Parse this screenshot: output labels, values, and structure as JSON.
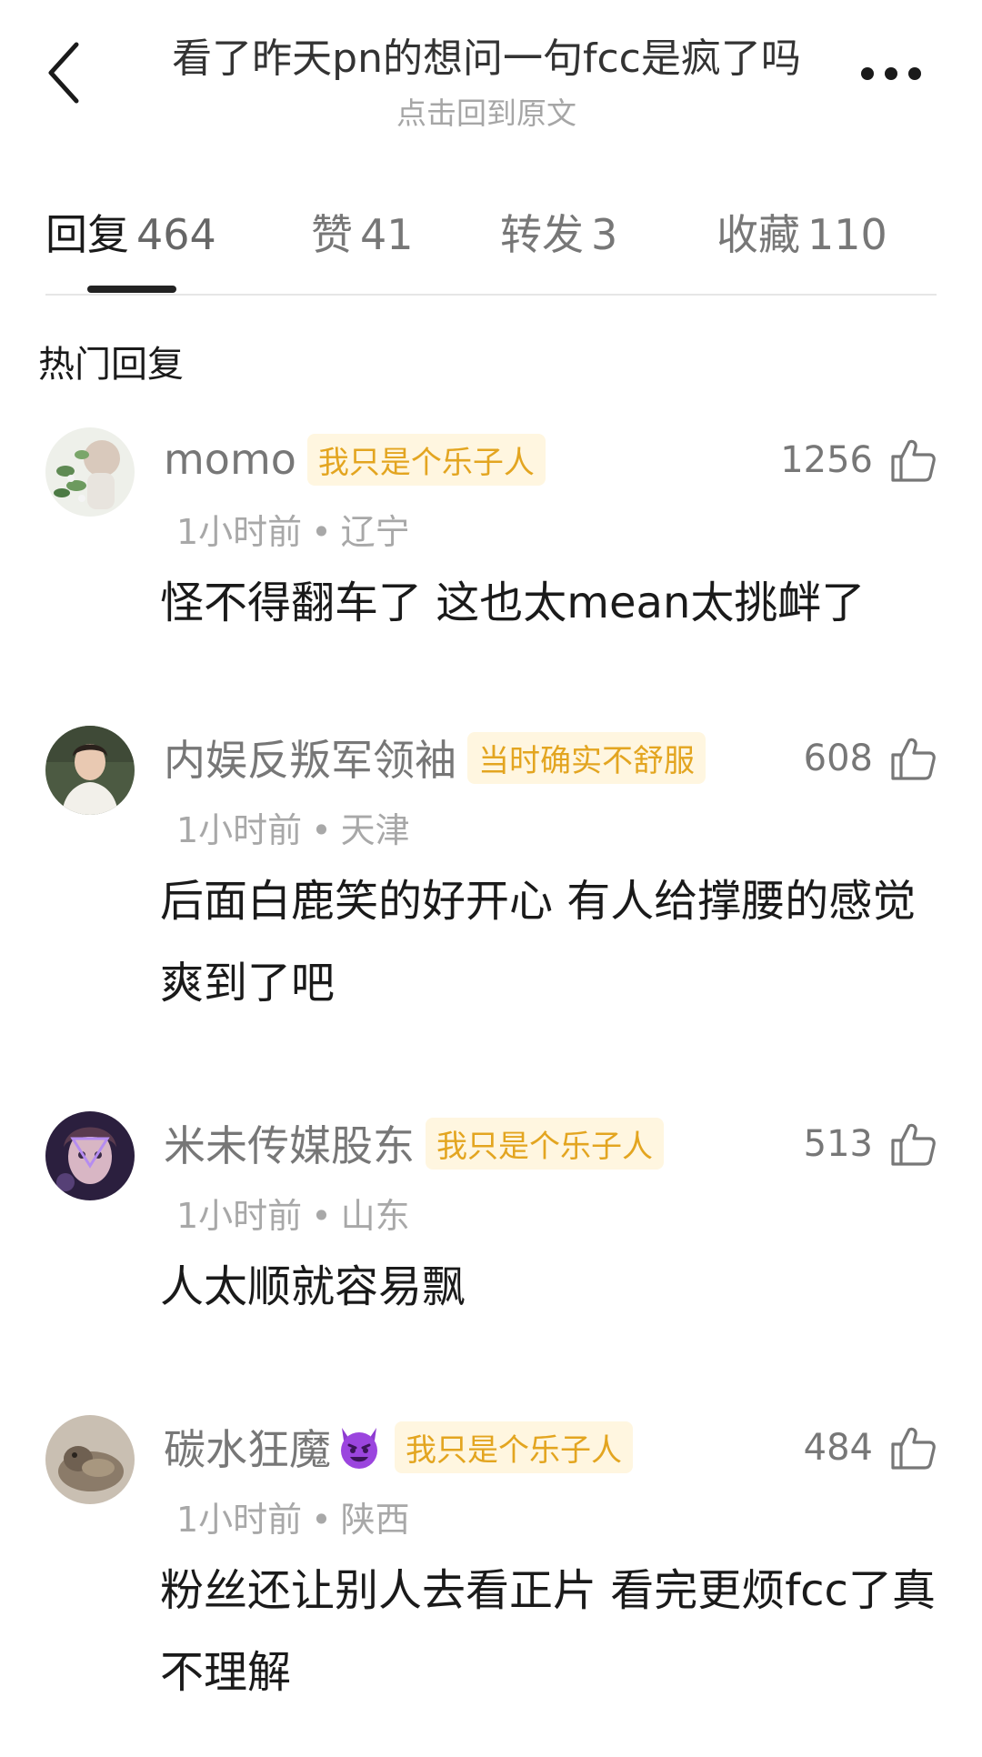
{
  "header": {
    "title": "看了昨天pn的想问一句fcc是疯了吗",
    "subtitle": "点击回到原文"
  },
  "tabs": [
    {
      "label": "回复",
      "count": "464"
    },
    {
      "label": "赞",
      "count": "41"
    },
    {
      "label": "转发",
      "count": "3"
    },
    {
      "label": "收藏",
      "count": "110"
    }
  ],
  "section_title": "热门回复",
  "comments": [
    {
      "username": "momo",
      "tag": "我只是个乐子人",
      "likes": "1256",
      "time": "1小时前",
      "location": "辽宁",
      "text": "怪不得翻车了 这也太mean太挑衅了"
    },
    {
      "username": "内娱反叛军领袖",
      "tag": "当时确实不舒服",
      "likes": "608",
      "time": "1小时前",
      "location": "天津",
      "text": "后面白鹿笑的好开心 有人给撑腰的感觉爽到了吧"
    },
    {
      "username": "米未传媒股东",
      "tag": "我只是个乐子人",
      "likes": "513",
      "time": "1小时前",
      "location": "山东",
      "text": "人太顺就容易飘"
    },
    {
      "username": "碳水狂魔",
      "badge_icon": "smiling-devil-emoji",
      "tag": "我只是个乐子人",
      "likes": "484",
      "time": "1小时前",
      "location": "陕西",
      "text": "粉丝还让别人去看正片 看完更烦fcc了真不理解"
    }
  ],
  "icons": {
    "back": "chevron-left-icon",
    "more": "more-dots-icon",
    "like": "thumbs-up-icon"
  },
  "colors": {
    "tag_text": "#e3a520",
    "tag_bg": "#fff6e0",
    "muted_text": "#777777",
    "meta_text": "#a8a8a8"
  }
}
